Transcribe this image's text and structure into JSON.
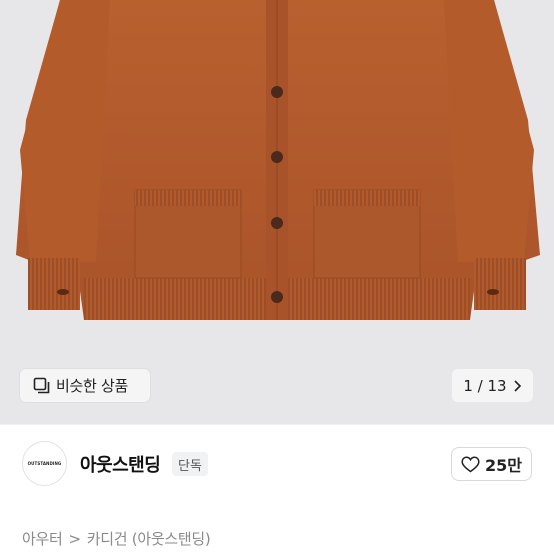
{
  "gallery": {
    "similar_products_label": "비슷한 상품",
    "pager": {
      "current": "1",
      "total": "13",
      "text": "1 / 13"
    }
  },
  "seller": {
    "logo_text": "OUTSTANDING",
    "name": "아웃스탠딩",
    "badge": "단독"
  },
  "like": {
    "count": "25만"
  },
  "breadcrumb": {
    "items": [
      "아우터",
      "카디건 (아웃스탠딩)"
    ],
    "separator": ">"
  },
  "colors": {
    "cardigan": "#b65a2e",
    "gallery_bg": "#e7e7e9",
    "button_bg": "#f5f5f6"
  }
}
